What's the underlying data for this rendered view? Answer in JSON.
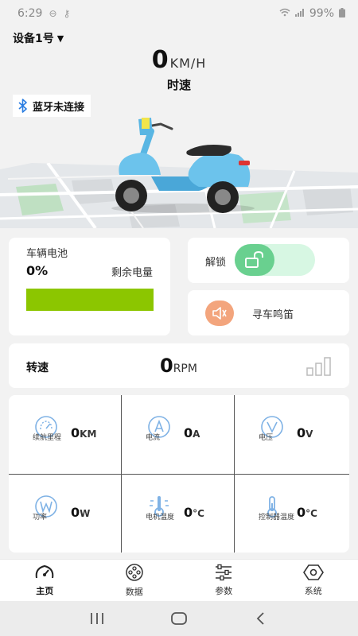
{
  "status_bar": {
    "time": "6:29",
    "battery": "99%"
  },
  "header": {
    "device": "设备1号"
  },
  "speed": {
    "value": "0",
    "unit": "KM/H",
    "label": "时速"
  },
  "bluetooth": {
    "status": "蓝牙未连接"
  },
  "battery_card": {
    "title": "车辆电池",
    "percent": "0%",
    "remaining_label": "剩余电量",
    "bar_color": "#8cc600",
    "bar_fill": 1.0
  },
  "unlock": {
    "label": "解锁",
    "state": "locked"
  },
  "horn": {
    "label": "寻车鸣笛"
  },
  "rpm": {
    "label": "转速",
    "value": "0",
    "unit": "RPM"
  },
  "metrics": [
    {
      "name": "续航里程",
      "value": "0",
      "unit": "KM",
      "icon": "speedometer-icon"
    },
    {
      "name": "电流",
      "value": "0",
      "unit": "A",
      "icon": "current-a-icon"
    },
    {
      "name": "电压",
      "value": "0",
      "unit": "V",
      "icon": "voltage-v-icon"
    },
    {
      "name": "功率",
      "value": "0",
      "unit": "W",
      "icon": "power-w-icon"
    },
    {
      "name": "电机温度",
      "value": "0",
      "unit": "°C",
      "icon": "motor-temp-icon"
    },
    {
      "name": "控制器温度",
      "value": "0",
      "unit": "°C",
      "icon": "controller-temp-icon"
    }
  ],
  "tabs": [
    {
      "label": "主页",
      "icon": "speedometer-icon",
      "active": true
    },
    {
      "label": "数据",
      "icon": "data-icon",
      "active": false
    },
    {
      "label": "参数",
      "icon": "sliders-icon",
      "active": false
    },
    {
      "label": "系统",
      "icon": "hexagon-settings-icon",
      "active": false
    }
  ],
  "colors": {
    "accent_green": "#69d08f",
    "toggle_bg": "#d7f7e3",
    "horn_orange": "#f3a57d",
    "icon_blue": "#7fb2e5",
    "battery_green": "#8cc600"
  }
}
